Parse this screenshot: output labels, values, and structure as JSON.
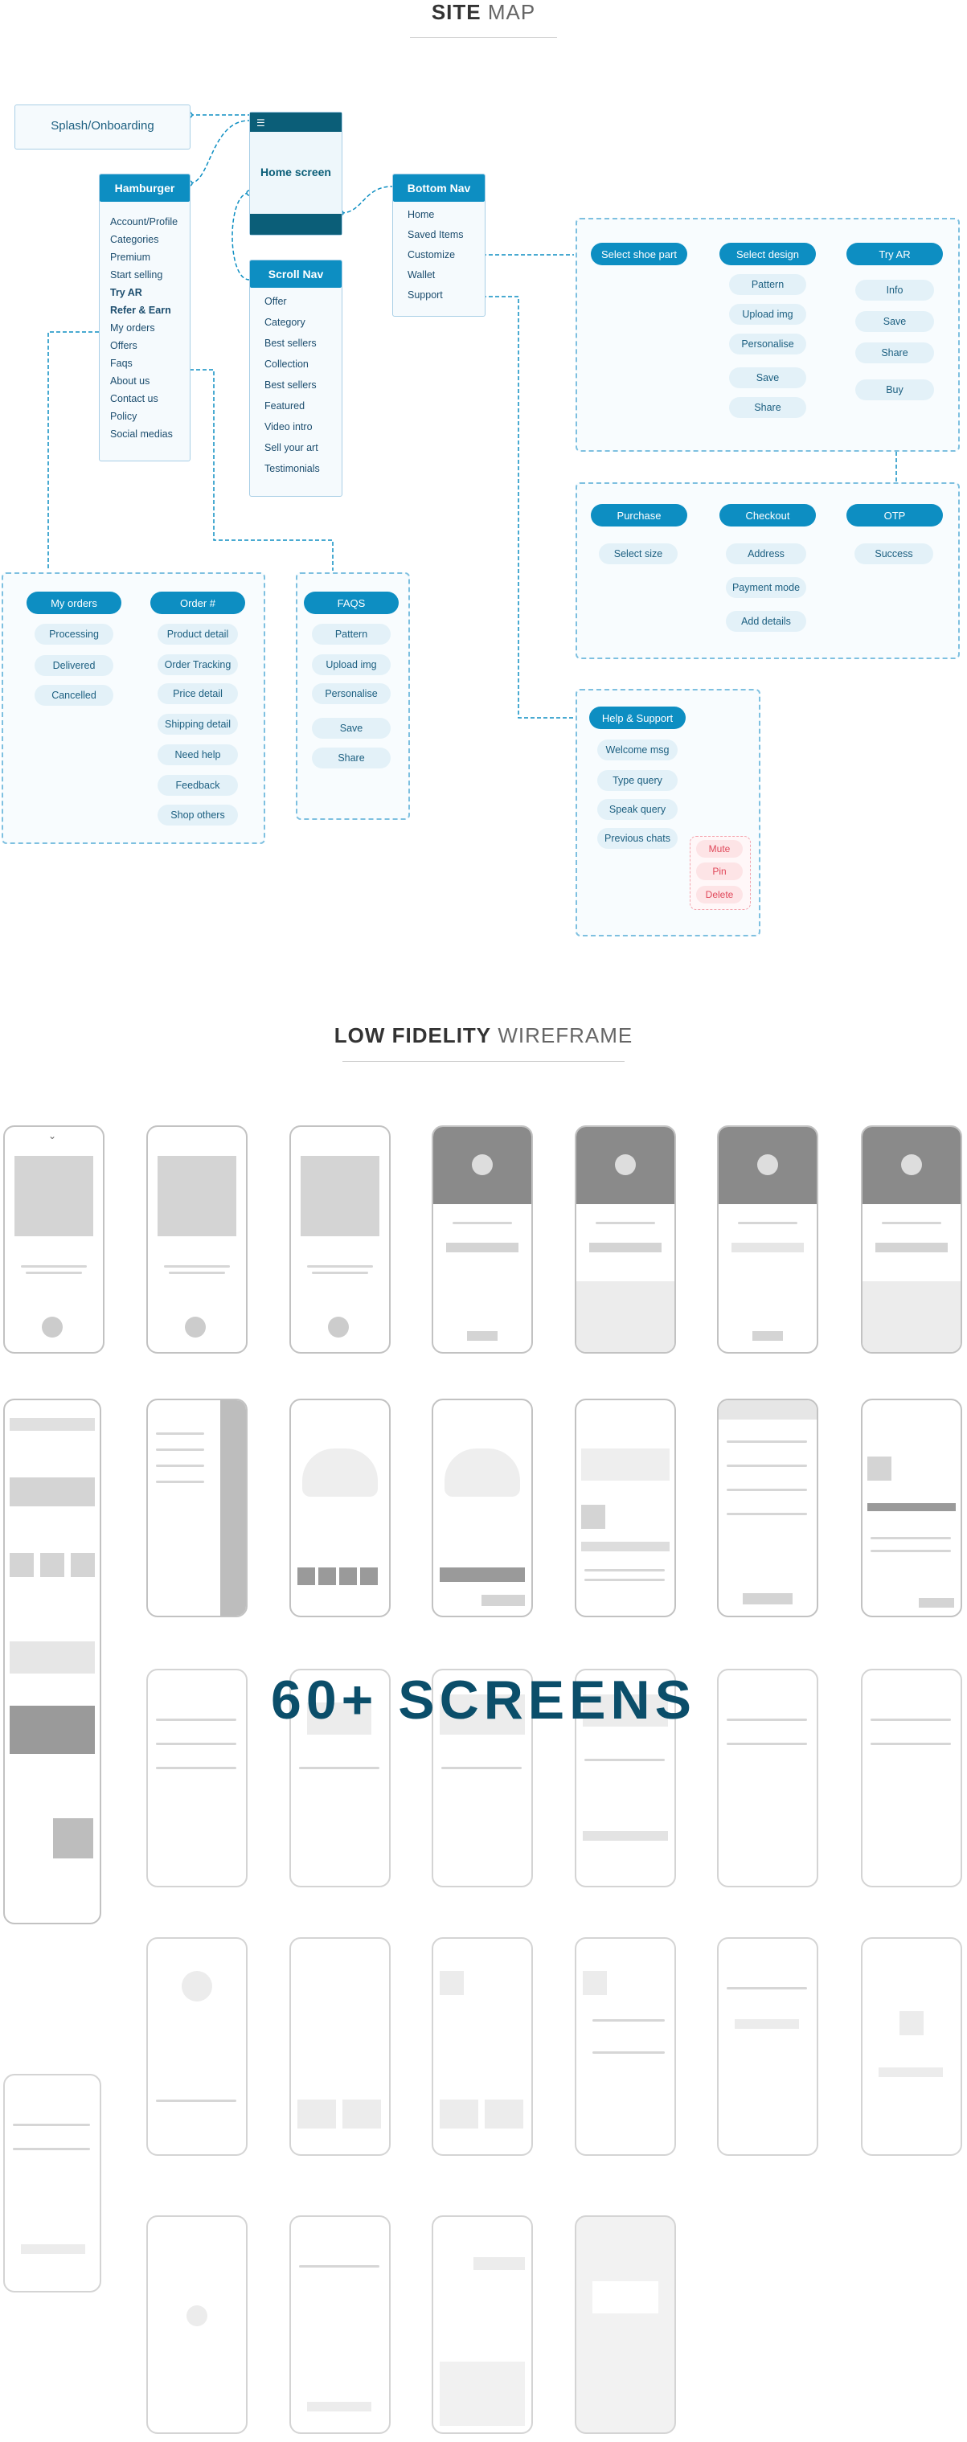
{
  "sitemap": {
    "title_bold": "SITE",
    "title_light": "MAP",
    "splash": "Splash/Onboarding",
    "home": "Home screen",
    "hamburger": {
      "title": "Hamburger",
      "items": [
        "Account/Profile",
        "Categories",
        "Premium",
        "Start selling",
        "Try AR",
        "Refer & Earn",
        "My orders",
        "Offers",
        "Faqs",
        "About us",
        "Contact us",
        "Policy",
        "Social medias"
      ]
    },
    "scroll_nav": {
      "title": "Scroll Nav",
      "items": [
        "Offer",
        "Category",
        "Best sellers",
        "Collection",
        "Best sellers",
        "Featured",
        "Video intro",
        "Sell your art",
        "Testimonials"
      ]
    },
    "bottom_nav": {
      "title": "Bottom Nav",
      "items": [
        "Home",
        "Saved Items",
        "Customize",
        "Wallet",
        "Support"
      ]
    },
    "customize": {
      "heads": [
        "Select shoe part",
        "Select design",
        "Try AR"
      ],
      "design_items": [
        "Pattern",
        "Upload img",
        "Personalise",
        "Save",
        "Share"
      ],
      "ar_items": [
        "Info",
        "Save",
        "Share",
        "Buy"
      ]
    },
    "purchase": {
      "heads": [
        "Purchase",
        "Checkout",
        "OTP"
      ],
      "purchase_items": [
        "Select size"
      ],
      "checkout_items": [
        "Address",
        "Payment mode",
        "Add details"
      ],
      "otp_items": [
        "Success"
      ]
    },
    "orders": {
      "heads": [
        "My orders",
        "Order #"
      ],
      "left_items": [
        "Processing",
        "Delivered",
        "Cancelled"
      ],
      "right_items": [
        "Product detail",
        "Order Tracking",
        "Price detail",
        "Shipping detail",
        "Need help",
        "Feedback",
        "Shop others"
      ]
    },
    "faqs": {
      "head": "FAQS",
      "items": [
        "Pattern",
        "Upload img",
        "Personalise",
        "Save",
        "Share"
      ]
    },
    "support": {
      "head": "Help & Support",
      "items": [
        "Welcome msg",
        "Type query",
        "Speak query",
        "Previous chats"
      ],
      "actions": [
        "Mute",
        "Pin",
        "Delete"
      ]
    }
  },
  "wireframe": {
    "title_bold": "LOW FIDELITY",
    "title_light": "WIREFRAME",
    "overlay": "60+ SCREENS"
  },
  "colors": {
    "accent": "#0d8ec2",
    "dark": "#0b5e78",
    "pill_bg": "#e3f1f8",
    "danger": "#e0485a"
  }
}
